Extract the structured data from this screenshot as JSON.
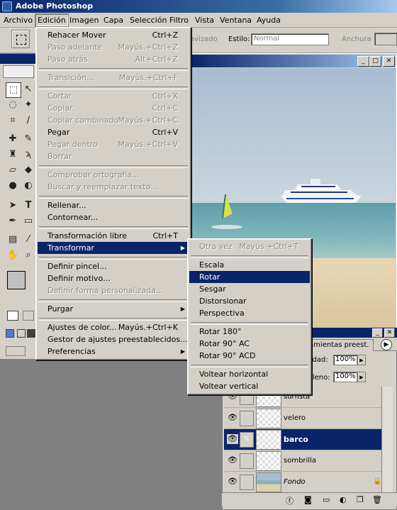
{
  "app": {
    "title": "Adobe Photoshop"
  },
  "menubar": [
    "Archivo",
    "Edición",
    "Imagen",
    "Capa",
    "Selección",
    "Filtro",
    "Vista",
    "Ventana",
    "Ayuda"
  ],
  "options": {
    "suavizado_label": "avizado",
    "estilo_label": "Estilo:",
    "estilo_value": "Normal",
    "anchura_label": "Anchura"
  },
  "edit_menu": [
    {
      "label": "Rehacer Mover",
      "shortcut": "Ctrl+Z",
      "disabled": false
    },
    {
      "label": "Paso adelante",
      "shortcut": "Mayús.+Ctrl+Z",
      "disabled": true
    },
    {
      "label": "Paso atrás",
      "shortcut": "Alt+Ctrl+Z",
      "disabled": true
    },
    {
      "sep": true
    },
    {
      "label": "Transición...",
      "shortcut": "Mayús.+Ctrl+F",
      "disabled": true
    },
    {
      "sep": true
    },
    {
      "label": "Cortar",
      "shortcut": "Ctrl+X",
      "disabled": true
    },
    {
      "label": "Copiar",
      "shortcut": "Ctrl+C",
      "disabled": true
    },
    {
      "label": "Copiar combinado",
      "shortcut": "Mayús.+Ctrl+C",
      "disabled": true
    },
    {
      "label": "Pegar",
      "shortcut": "Ctrl+V",
      "disabled": false
    },
    {
      "label": "Pegar dentro",
      "shortcut": "Mayús.+Ctrl+V",
      "disabled": true
    },
    {
      "label": "Borrar",
      "shortcut": "",
      "disabled": true
    },
    {
      "sep": true
    },
    {
      "label": "Comprobar ortografía...",
      "shortcut": "",
      "disabled": true
    },
    {
      "label": "Buscar y reemplazar texto...",
      "shortcut": "",
      "disabled": true
    },
    {
      "sep": true
    },
    {
      "label": "Rellenar...",
      "shortcut": "",
      "disabled": false
    },
    {
      "label": "Contornear...",
      "shortcut": "",
      "disabled": false
    },
    {
      "sep": true
    },
    {
      "label": "Transformación libre",
      "shortcut": "Ctrl+T",
      "disabled": false
    },
    {
      "label": "Transformar",
      "shortcut": "",
      "disabled": false,
      "submenu": true,
      "highlighted": true
    },
    {
      "sep": true
    },
    {
      "label": "Definir pincel...",
      "shortcut": "",
      "disabled": false
    },
    {
      "label": "Definir motivo...",
      "shortcut": "",
      "disabled": false
    },
    {
      "label": "Definir forma personalizada...",
      "shortcut": "",
      "disabled": true
    },
    {
      "sep": true
    },
    {
      "label": "Purgar",
      "shortcut": "",
      "disabled": false,
      "submenu": true
    },
    {
      "sep": true
    },
    {
      "label": "Ajustes de color...",
      "shortcut": "Mayús.+Ctrl+K",
      "disabled": false
    },
    {
      "label": "Gestor de ajustes preestablecidos...",
      "shortcut": "",
      "disabled": false
    },
    {
      "label": "Preferencias",
      "shortcut": "",
      "disabled": false,
      "submenu": true
    }
  ],
  "transform_menu": [
    {
      "label": "Otra vez",
      "shortcut": "Mayús.+Ctrl+T",
      "disabled": true
    },
    {
      "sep": true
    },
    {
      "label": "Escala",
      "disabled": false
    },
    {
      "label": "Rotar",
      "disabled": false,
      "highlighted": true
    },
    {
      "label": "Sesgar",
      "disabled": false
    },
    {
      "label": "Distorsionar",
      "disabled": false
    },
    {
      "label": "Perspectiva",
      "disabled": false
    },
    {
      "sep": true
    },
    {
      "label": "Rotar 180°",
      "disabled": false
    },
    {
      "label": "Rotar 90° AC",
      "disabled": false
    },
    {
      "label": "Rotar 90° ACD",
      "disabled": false
    },
    {
      "sep": true
    },
    {
      "label": "Voltear horizontal",
      "disabled": false
    },
    {
      "label": "Voltear vertical",
      "disabled": false
    }
  ],
  "layers_panel": {
    "tab_label": "rramientas preest.",
    "opacity_label": "acidad:",
    "opacity_value": "100%",
    "fill_label": "relleno:",
    "fill_value": "100%",
    "layers": [
      {
        "name": "surfista",
        "selected": false,
        "italic": false
      },
      {
        "name": "velero",
        "selected": false,
        "italic": false
      },
      {
        "name": "barco",
        "selected": true,
        "italic": false
      },
      {
        "name": "sombrilla",
        "selected": false,
        "italic": false
      },
      {
        "name": "Fondo",
        "selected": false,
        "italic": true
      }
    ]
  }
}
